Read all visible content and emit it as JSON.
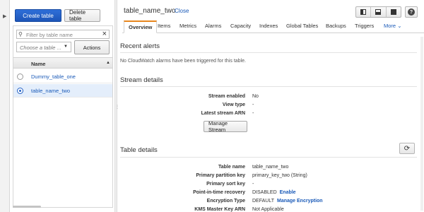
{
  "sidebar": {
    "create_table": "Create table",
    "delete_table": "Delete table",
    "filter_placeholder": "Filter by table name",
    "select_placeholder": "Choose a table ...",
    "actions": "Actions",
    "column_name": "Name",
    "tables": [
      {
        "name": "Dummy_table_one",
        "selected": false
      },
      {
        "name": "table_name_two",
        "selected": true
      }
    ]
  },
  "header": {
    "title": "table_name_two",
    "close": "Close"
  },
  "tabs": [
    "Overview",
    "Items",
    "Metrics",
    "Alarms",
    "Capacity",
    "Indexes",
    "Global Tables",
    "Backups",
    "Triggers",
    "More"
  ],
  "recent_alerts": {
    "title": "Recent alerts",
    "message": "No CloudWatch alarms have been triggered for this table."
  },
  "stream": {
    "title": "Stream details",
    "fields": [
      {
        "key": "Stream enabled",
        "value": "No"
      },
      {
        "key": "View type",
        "value": "-"
      },
      {
        "key": "Latest stream ARN",
        "value": "-"
      }
    ],
    "manage_button": "Manage Stream"
  },
  "table_details": {
    "title": "Table details",
    "fields": [
      {
        "key": "Table name",
        "value": "table_name_two"
      },
      {
        "key": "Primary partition key",
        "value": "primary_key_two (String)"
      },
      {
        "key": "Primary sort key",
        "value": "-"
      },
      {
        "key": "Point-in-time recovery",
        "value": "DISABLED",
        "link": "Enable"
      },
      {
        "key": "Encryption Type",
        "value": "DEFAULT",
        "link": "Manage Encryption"
      },
      {
        "key": "KMS Master Key ARN",
        "value": "Not Applicable"
      }
    ]
  },
  "colors": {
    "primary": "#1d55b8",
    "link": "#1a5ab8",
    "tab_accent": "#e8871e",
    "selected_row": "#e4eefb"
  }
}
